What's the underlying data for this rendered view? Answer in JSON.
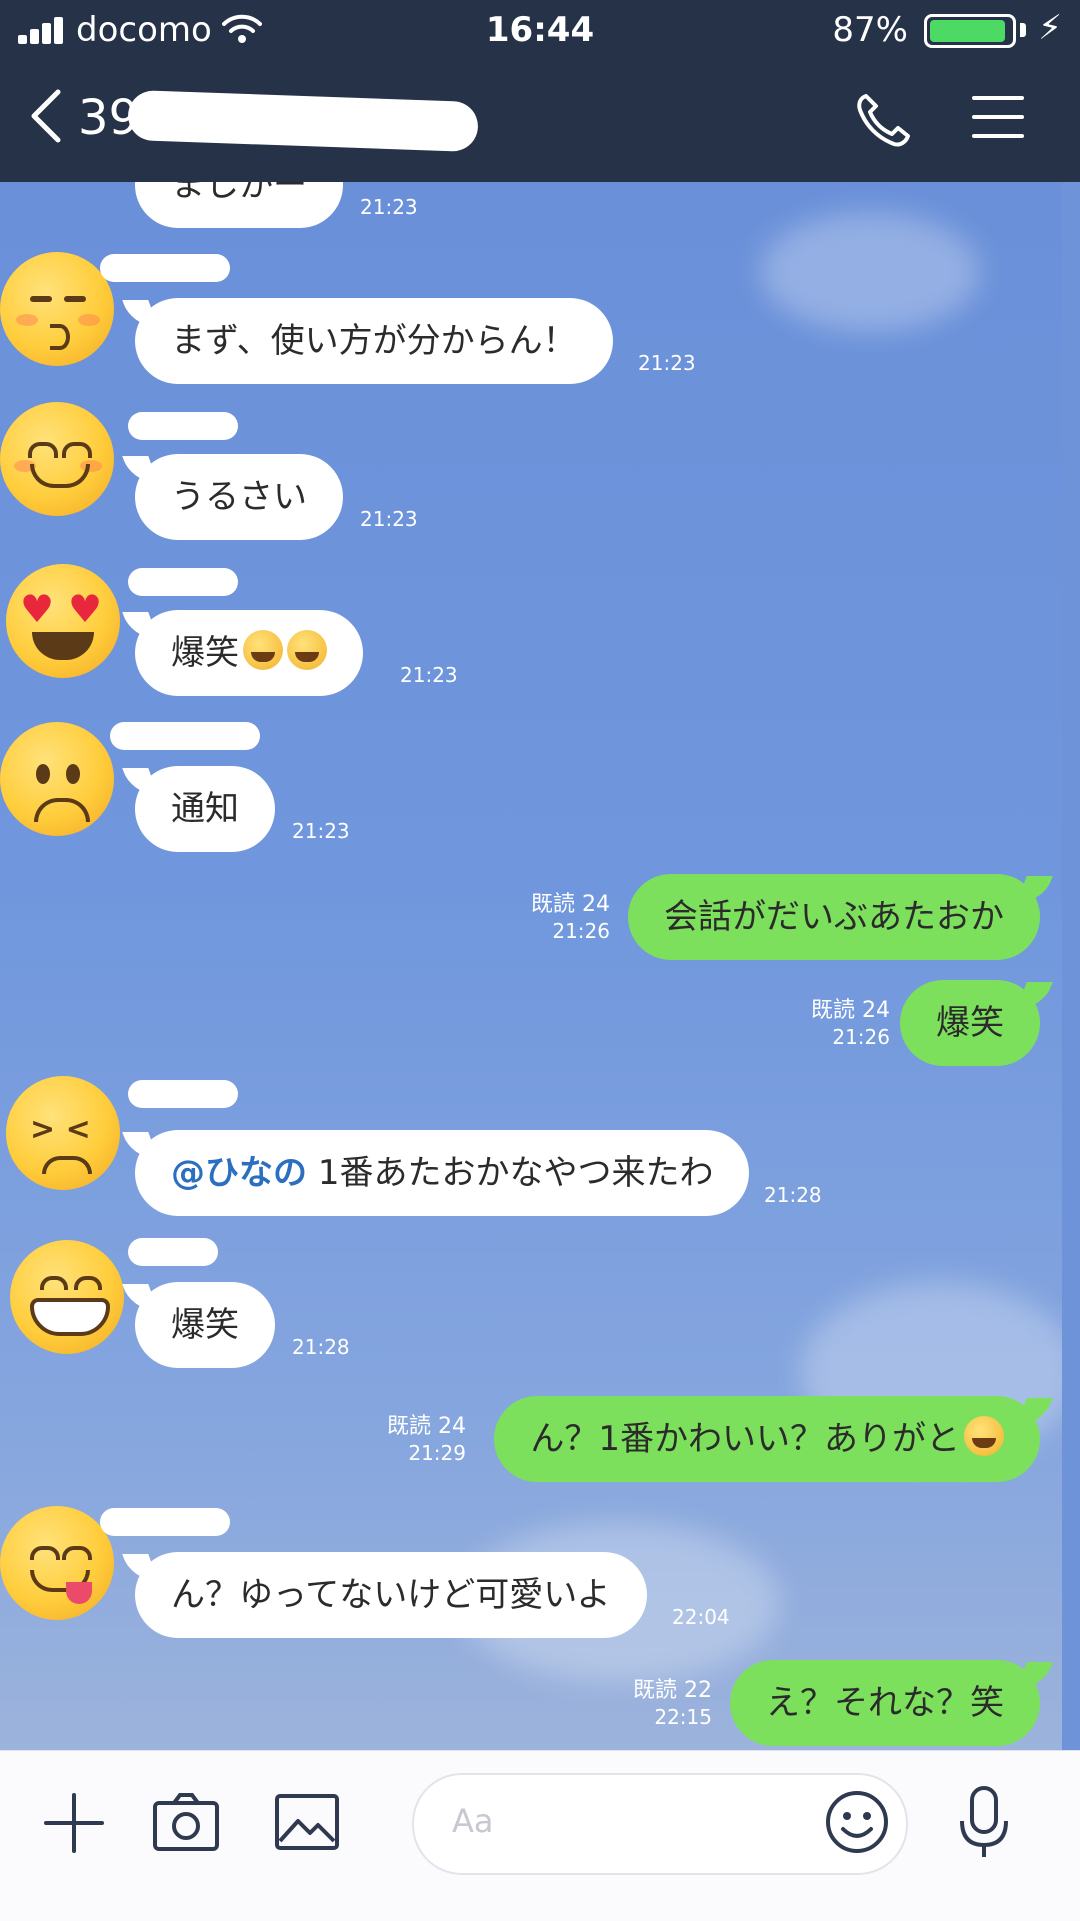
{
  "status_bar": {
    "carrier": "docomo",
    "time": "16:44",
    "battery_pct": "87%",
    "icons": [
      "signal-icon",
      "wifi-icon",
      "battery-icon",
      "charging-icon"
    ]
  },
  "nav": {
    "title": "39",
    "icons": [
      "back-chevron-icon",
      "phone-icon",
      "menu-icon"
    ]
  },
  "messages": [
    {
      "side": "in",
      "text": "ましかー",
      "time": "21:23"
    },
    {
      "side": "in",
      "text": "まず、使い方が分からん！",
      "time": "21:23",
      "avatar": "kissing-face"
    },
    {
      "side": "in",
      "text": "うるさい",
      "time": "21:23",
      "avatar": "smiling-face"
    },
    {
      "side": "in",
      "text": "爆笑",
      "time": "21:23",
      "avatar": "heart-eyes-face",
      "emoji": [
        "tears-of-joy",
        "tears-of-joy"
      ]
    },
    {
      "side": "in",
      "text": "通知",
      "time": "21:23",
      "avatar": "frowning-face"
    },
    {
      "side": "out",
      "text": "会話がだいぶあたおか",
      "read": "既読 24",
      "time": "21:26"
    },
    {
      "side": "out",
      "text": "爆笑",
      "read": "既読 24",
      "time": "21:26"
    },
    {
      "side": "in",
      "mention": "@ひなの",
      "text": "1番あたおかなやつ来たわ",
      "time": "21:28",
      "avatar": "persevering-face"
    },
    {
      "side": "in",
      "text": "爆笑",
      "time": "21:28",
      "avatar": "grinning-face"
    },
    {
      "side": "out",
      "text": "ん？1番かわいい？ありがと",
      "read": "既読 24",
      "time": "21:29",
      "emoji": [
        "shushing-face"
      ]
    },
    {
      "side": "in",
      "text": "ん？ゆってないけど可愛いよ",
      "time": "22:04",
      "avatar": "yum-face"
    },
    {
      "side": "out",
      "text": "え？それな？笑",
      "read": "既読 22",
      "time": "22:15"
    }
  ],
  "input": {
    "placeholder": "Aa",
    "icons": [
      "plus-icon",
      "camera-icon",
      "image-icon",
      "emoji-icon",
      "microphone-icon"
    ]
  }
}
